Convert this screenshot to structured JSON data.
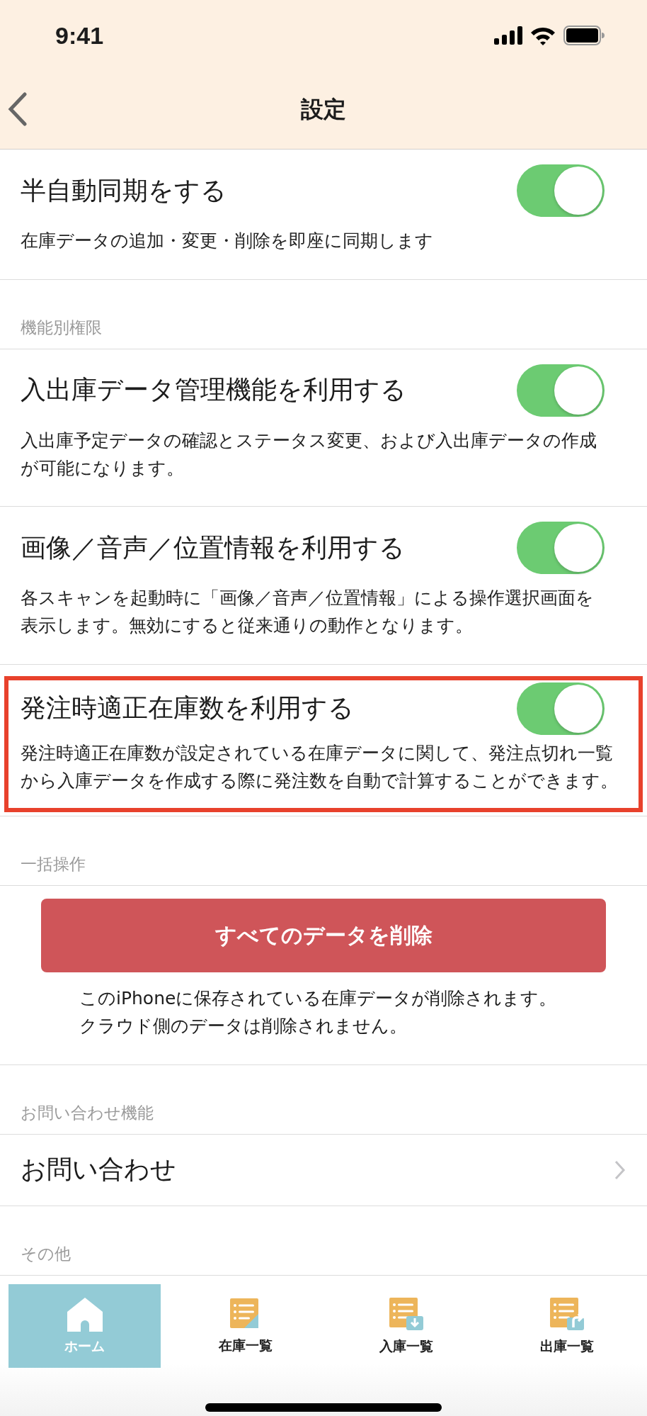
{
  "status_bar": {
    "time": "9:41"
  },
  "nav": {
    "title": "設定"
  },
  "sections": [
    {
      "items": [
        {
          "kind": "toggle",
          "label": "半自動同期をする",
          "description": "在庫データの追加・変更・削除を即座に同期します",
          "on": true,
          "highlighted": false
        }
      ]
    },
    {
      "header": "機能別権限",
      "items": [
        {
          "kind": "toggle",
          "label": "入出庫データ管理機能を利用する",
          "description": "入出庫予定データの確認とステータス変更、および入出庫データの作成が可能になります。",
          "on": true,
          "highlighted": false
        },
        {
          "kind": "toggle",
          "label": "画像／音声／位置情報を利用する",
          "description": "各スキャンを起動時に「画像／音声／位置情報」による操作選択画面を表示します。無効にすると従来通りの動作となります。",
          "on": true,
          "highlighted": false
        },
        {
          "kind": "toggle",
          "label": "発注時適正在庫数を利用する",
          "description": "発注時適正在庫数が設定されている在庫データに関して、発注点切れ一覧から入庫データを作成する際に発注数を自動で計算することができます。",
          "on": true,
          "highlighted": true
        }
      ]
    },
    {
      "header": "一括操作",
      "items": [
        {
          "kind": "danger",
          "label": "すべてのデータを削除",
          "description": "このiPhoneに保存されている在庫データが削除されます。クラウド側のデータは削除されません。"
        }
      ]
    },
    {
      "header": "お問い合わせ機能",
      "items": [
        {
          "kind": "link",
          "label": "お問い合わせ"
        }
      ]
    },
    {
      "header": "その他"
    }
  ],
  "tabs": [
    {
      "label": "ホーム",
      "kind": "home",
      "selected": true
    },
    {
      "label": "在庫一覧",
      "kind": "list",
      "selected": false
    },
    {
      "label": "入庫一覧",
      "kind": "in",
      "selected": false
    },
    {
      "label": "出庫一覧",
      "kind": "out",
      "selected": false
    }
  ]
}
